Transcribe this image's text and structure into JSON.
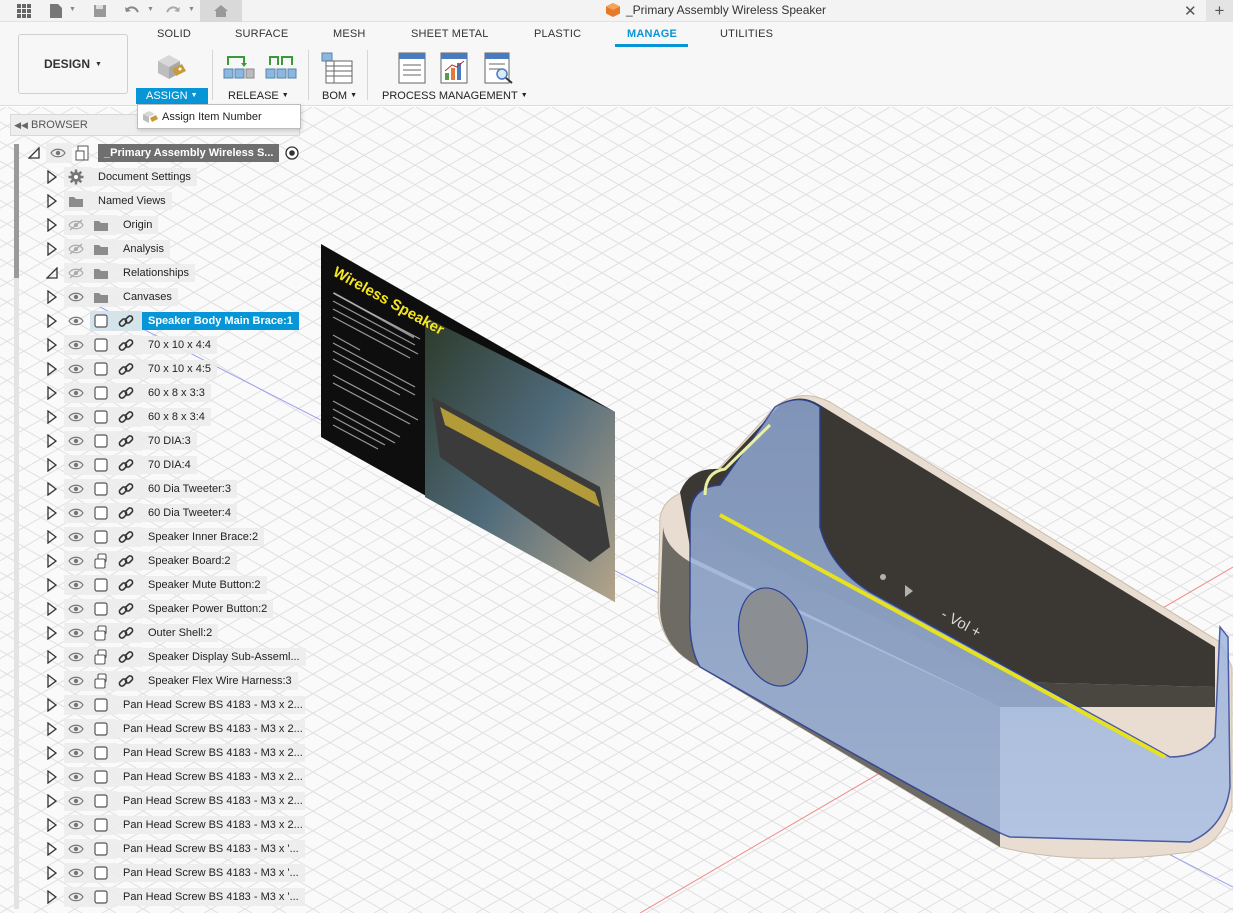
{
  "document": {
    "title": "_Primary Assembly Wireless Speaker"
  },
  "ribbon": {
    "workspace": "DESIGN",
    "tabs": [
      "SOLID",
      "SURFACE",
      "MESH",
      "SHEET METAL",
      "PLASTIC",
      "MANAGE",
      "UTILITIES"
    ],
    "active_tab": "MANAGE",
    "groups": {
      "assign": "ASSIGN",
      "release": "RELEASE",
      "bom": "BOM",
      "process": "PROCESS MANAGEMENT"
    }
  },
  "dropdown": {
    "item": "Assign Item Number"
  },
  "browser": {
    "header": "BROWSER",
    "root": "_Primary Assembly Wireless S...",
    "rows": [
      "Document Settings",
      "Named Views",
      "Origin",
      "Analysis",
      "Relationships",
      "Canvases",
      "Speaker Body Main Brace:1",
      "70 x 10 x 4:4",
      "70 x 10 x 4:5",
      "60 x 8 x 3:3",
      "60 x 8 x 3:4",
      "70 DIA:3",
      "70 DIA:4",
      "60 Dia Tweeter:3",
      "60 Dia Tweeter:4",
      "Speaker Inner Brace:2",
      "Speaker Board:2",
      "Speaker Mute Button:2",
      "Speaker Power Button:2",
      "Outer Shell:2",
      "Speaker Display Sub-Asseml...",
      "Speaker Flex Wire Harness:3",
      "Pan Head Screw BS 4183 - M3 x 2...",
      "Pan Head Screw BS 4183 - M3 x 2...",
      "Pan Head Screw BS 4183 - M3 x 2...",
      "Pan Head Screw BS 4183 - M3 x 2...",
      "Pan Head Screw BS 4183 - M3 x 2...",
      "Pan Head Screw BS 4183 - M3 x 2...",
      "Pan Head Screw BS 4183 - M3 x '...",
      "Pan Head Screw BS 4183 - M3 x '...",
      "Pan Head Screw BS 4183 - M3 x '..."
    ]
  },
  "canvas_image": {
    "title": "Wireless Speaker"
  },
  "model": {
    "display_text": "- Vol +"
  },
  "colors": {
    "accent": "#0696d7",
    "selection": "#0696d7",
    "shell_blue": "#9fb8e0"
  }
}
